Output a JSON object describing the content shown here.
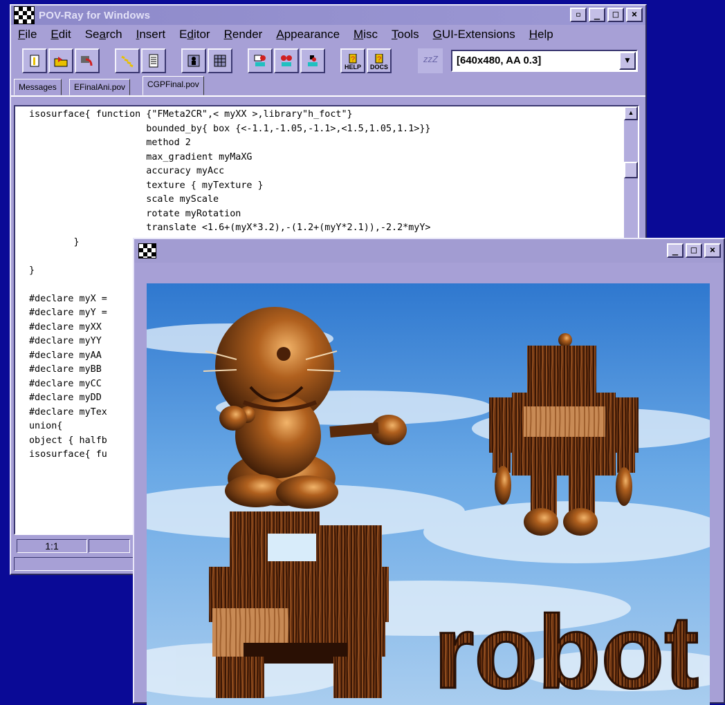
{
  "main_window": {
    "title": "POV-Ray for Windows",
    "menu": [
      {
        "pre": "",
        "ul": "F",
        "post": "ile"
      },
      {
        "pre": "",
        "ul": "E",
        "post": "dit"
      },
      {
        "pre": "Se",
        "ul": "a",
        "post": "rch"
      },
      {
        "pre": "",
        "ul": "I",
        "post": "nsert"
      },
      {
        "pre": "E",
        "ul": "d",
        "post": "itor"
      },
      {
        "pre": "",
        "ul": "R",
        "post": "ender"
      },
      {
        "pre": "",
        "ul": "A",
        "post": "ppearance"
      },
      {
        "pre": "",
        "ul": "M",
        "post": "isc"
      },
      {
        "pre": "",
        "ul": "T",
        "post": "ools"
      },
      {
        "pre": "",
        "ul": "G",
        "post": "UI-Extensions"
      },
      {
        "pre": "",
        "ul": "H",
        "post": "elp"
      }
    ],
    "toolbar": {
      "help_label": "HELP",
      "docs_label": "DOCS",
      "sleep_label": "zzZ",
      "resolution_value": "[640x480, AA 0.3]"
    },
    "tabs": [
      "Messages",
      "EFinalAni.pov",
      "CGPFinal.pov"
    ],
    "code_lines": [
      "isosurface{ function {\"FMeta2CR\",< myXX >,library\"h_foct\"}",
      "                     bounded_by{ box {<-1.1,-1.05,-1.1>,<1.5,1.05,1.1>}}",
      "                     method 2",
      "                     max_gradient myMaXG",
      "                     accuracy myAcc",
      "                     texture { myTexture }",
      "                     scale myScale",
      "                     rotate myRotation",
      "                     translate <1.6+(myX*3.2),-(1.2+(myY*2.1)),-2.2*myY>",
      "        }",
      "",
      "}",
      "",
      "#declare myX =",
      "#declare myY =",
      "#declare myXX",
      "#declare myYY",
      "#declare myAA",
      "#declare myBB",
      "#declare myCC",
      "#declare myDD",
      "#declare myTex",
      "union{",
      "object { halfb",
      "isosurface{ fu"
    ],
    "status": {
      "position": "1:1"
    }
  },
  "render_window": {
    "scene_text": "robot"
  },
  "colors": {
    "desktop": "#0a0a96",
    "window_face": "#a7a0d6",
    "sky_top": "#3f86d8",
    "wood": "#7a3d14"
  }
}
